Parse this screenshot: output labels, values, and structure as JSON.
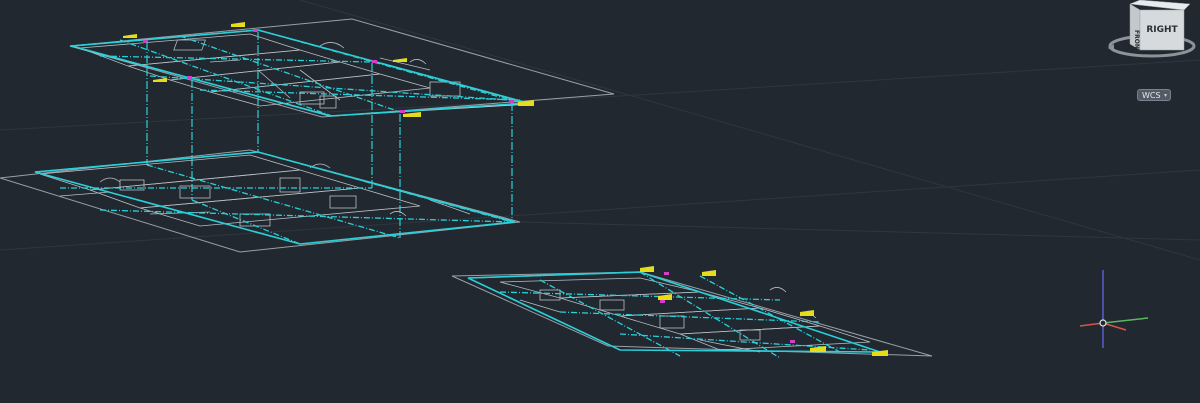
{
  "app": {
    "viewport_label": "3D model viewport"
  },
  "viewcube": {
    "face_front": "FRONT",
    "face_right": "RIGHT"
  },
  "wcs_menu": {
    "label": "WCS",
    "caret": "▾"
  },
  "colors": {
    "background": "#212830",
    "plan_lines": "#b8bec4",
    "grid_lines": "#cfd4d8",
    "axis_cyan": "#2ad0d8",
    "elevation_yellow": "#e6dc1a",
    "marker_magenta": "#d63cc8",
    "ucs_x": "#d9534f",
    "ucs_y": "#5cb85c",
    "ucs_z": "#5b5bd6"
  },
  "icons": {
    "viewcube": "viewcube-icon",
    "compass": "compass-ring-icon",
    "ucs": "ucs-axis-icon"
  }
}
